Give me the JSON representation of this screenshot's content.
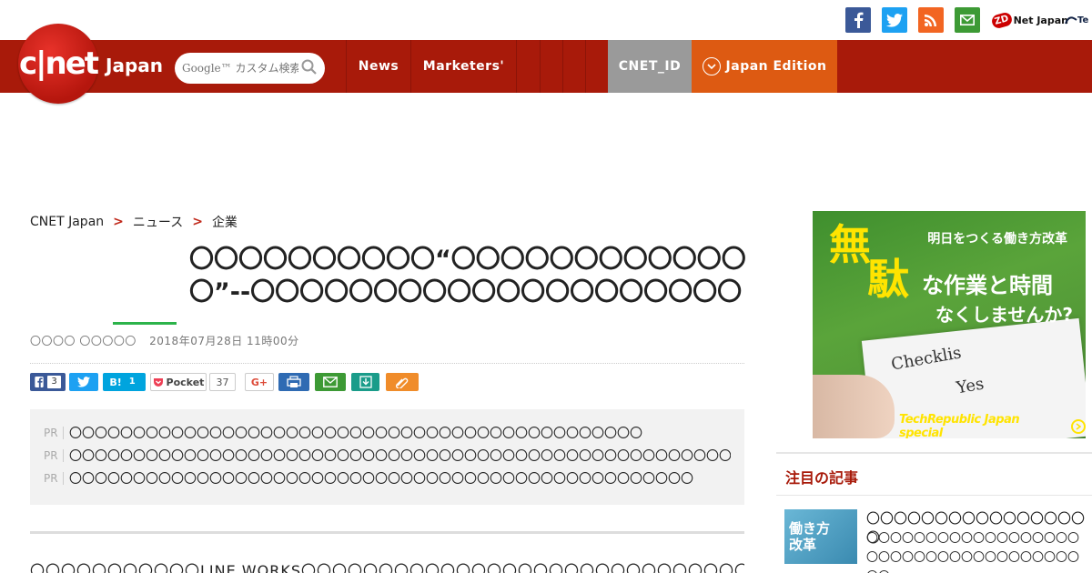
{
  "network": {
    "social": [
      {
        "name": "facebook",
        "color": "#3b5998",
        "glyph": "f"
      },
      {
        "name": "twitter",
        "color": "#1da1f2",
        "glyph": "t"
      },
      {
        "name": "rss",
        "color": "#f26522",
        "glyph": "rss"
      },
      {
        "name": "mail",
        "color": "#3d9a35",
        "glyph": "mail"
      }
    ],
    "zdnet": "Net Japan",
    "zdmark": "ZD",
    "techrepublic": "Te"
  },
  "header": {
    "logo_text": "c|net",
    "logo_sub": "Japan",
    "search_placeholder": "Google™ カスタム検索",
    "nav": [
      "News",
      "Marketers'",
      "",
      "",
      ""
    ],
    "cnet_id": "CNET_ID",
    "edition": "Japan Edition",
    "brand_color": "#a81a0a",
    "edition_color": "#dd5a12"
  },
  "breadcrumb": [
    "CNET Japan",
    "ニュース",
    "企業"
  ],
  "article": {
    "title": "〇〇〇〇〇〇〇〇〇〇“〇〇〇〇〇〇〇〇〇〇〇〇〇”--〇〇〇〇〇〇〇〇〇〇〇〇〇〇〇〇〇〇〇〇",
    "author": "〇〇〇〇 〇〇〇〇〇",
    "date": "2018年07月28日 11時00分",
    "body_start": "〇〇〇〇〇〇〇〇〇〇〇LINE WORKS〇〇〇〇〇〇〇〇〇〇〇〇〇〇〇〇〇〇〇〇〇〇〇〇〇〇〇〇〇〇〇〇〇〇〇〇〇〇〇〇〇"
  },
  "share": {
    "facebook_count": "3",
    "hatena_label": "B!",
    "hatena_count": "1",
    "pocket_label": "Pocket",
    "pocket_count": "37",
    "gplus_label": "G+"
  },
  "pr": [
    {
      "tag": "PR",
      "text": "〇〇〇〇〇〇〇〇〇〇〇〇〇〇〇〇〇〇〇〇〇〇〇〇〇〇〇〇〇〇〇〇〇〇〇〇〇〇〇〇〇〇〇〇〇"
    },
    {
      "tag": "PR",
      "text": "〇〇〇〇〇〇〇〇〇〇〇〇〇〇〇〇〇〇〇〇〇〇〇〇〇〇〇〇〇〇〇〇〇〇〇〇〇〇〇〇〇〇〇〇〇〇〇〇〇〇〇〇"
    },
    {
      "tag": "PR",
      "text": "〇〇〇〇〇〇〇〇〇〇〇〇〇〇〇〇〇〇〇〇〇〇〇〇〇〇〇〇〇〇〇〇〇〇〇〇〇〇〇〇〇〇〇〇〇〇〇〇〇"
    }
  ],
  "ad": {
    "kicker": "明日をつくる働き方改革",
    "big1": "無",
    "big2": "駄",
    "mid": "な作業と時間",
    "sub": "なくしませんか?",
    "check_text": "Checklis",
    "yes_text": "Yes",
    "tag": "TechRepublic Japan special"
  },
  "sidebar": {
    "heading": "注目の記事",
    "item_thumb": "働き方\n改革",
    "item_title": "〇〇〇〇〇〇〇〇〇〇〇〇〇〇〇〇〇",
    "item_desc": "〇〇〇〇〇〇〇〇〇〇〇〇〇〇〇〇〇〇〇〇〇〇〇〇〇〇〇〇〇〇〇〇〇〇〇〇〇〇"
  }
}
